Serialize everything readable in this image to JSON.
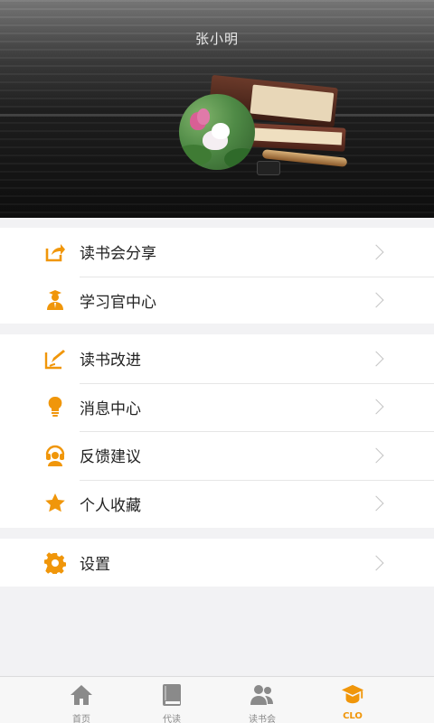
{
  "profile": {
    "username": "张小明"
  },
  "menu": {
    "group1": [
      {
        "label": "读书会分享",
        "icon": "share-icon"
      },
      {
        "label": "学习官中心",
        "icon": "officer-icon"
      }
    ],
    "group2": [
      {
        "label": "读书改进",
        "icon": "edit-icon"
      },
      {
        "label": "消息中心",
        "icon": "bulb-icon"
      },
      {
        "label": "反馈建议",
        "icon": "headset-icon"
      },
      {
        "label": "个人收藏",
        "icon": "star-icon"
      }
    ],
    "group3": [
      {
        "label": "设置",
        "icon": "gear-icon"
      }
    ]
  },
  "tabbar": {
    "tabs": [
      {
        "label": "首页",
        "icon": "home-icon"
      },
      {
        "label": "代读",
        "icon": "book-icon"
      },
      {
        "label": "读书会",
        "icon": "group-icon"
      },
      {
        "label": "CLO",
        "icon": "graduation-cap-icon"
      }
    ],
    "active_index": 3
  },
  "colors": {
    "accent": "#f0960a",
    "tab_inactive": "#8a8a8a",
    "chevron": "#c5c5c5"
  }
}
